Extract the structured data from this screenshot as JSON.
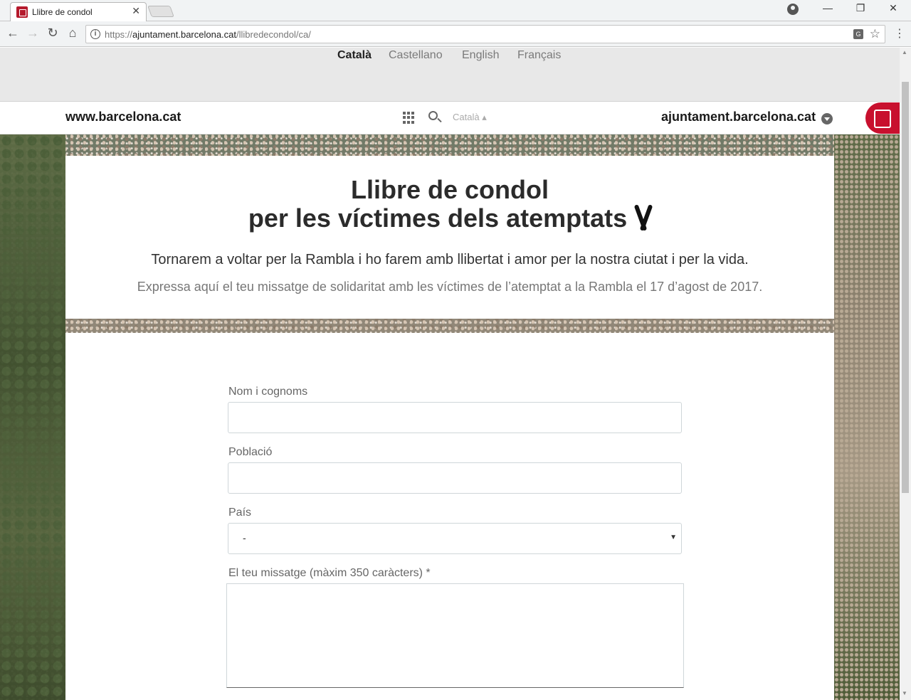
{
  "browser": {
    "tab_title": "Llibre de condol",
    "tab_close": "✕",
    "url_prefix": "https://",
    "url_host": "ajuntament.barcelona.cat",
    "url_path": "/llibredecondol/ca/",
    "info_glyph": "i",
    "back": "←",
    "forward": "→",
    "reload": "↻",
    "home": "⌂",
    "star": "☆",
    "menu": "⋮",
    "minimize": "—",
    "restore": "❐",
    "close": "✕",
    "translate_glyph": "G"
  },
  "languages": [
    {
      "label": "Català",
      "active": true
    },
    {
      "label": "Castellano",
      "active": false
    },
    {
      "label": "English",
      "active": false
    },
    {
      "label": "Français",
      "active": false
    }
  ],
  "sitebar": {
    "left_link": "www.barcelona.cat",
    "right_link": "ajuntament.barcelona.cat",
    "lang_select": "Català ▴"
  },
  "header": {
    "title_line1": "Llibre de condol",
    "title_line2": "per les víctimes dels atemptats",
    "subtitle": "Tornarem a voltar per la Rambla i ho farem amb llibertat i amor per la nostra ciutat i per la vida.",
    "subtext": "Expressa aquí el teu missatge de solidaritat amb les víctimes de l’atemptat a la Rambla el 17 d’agost de 2017."
  },
  "form": {
    "name_label": "Nom i cognoms",
    "name_value": "",
    "town_label": "Població",
    "town_value": "",
    "country_label": "País",
    "country_value": "-",
    "message_label": "El teu missatge (màxim 350 caràcters) *",
    "message_value": ""
  }
}
